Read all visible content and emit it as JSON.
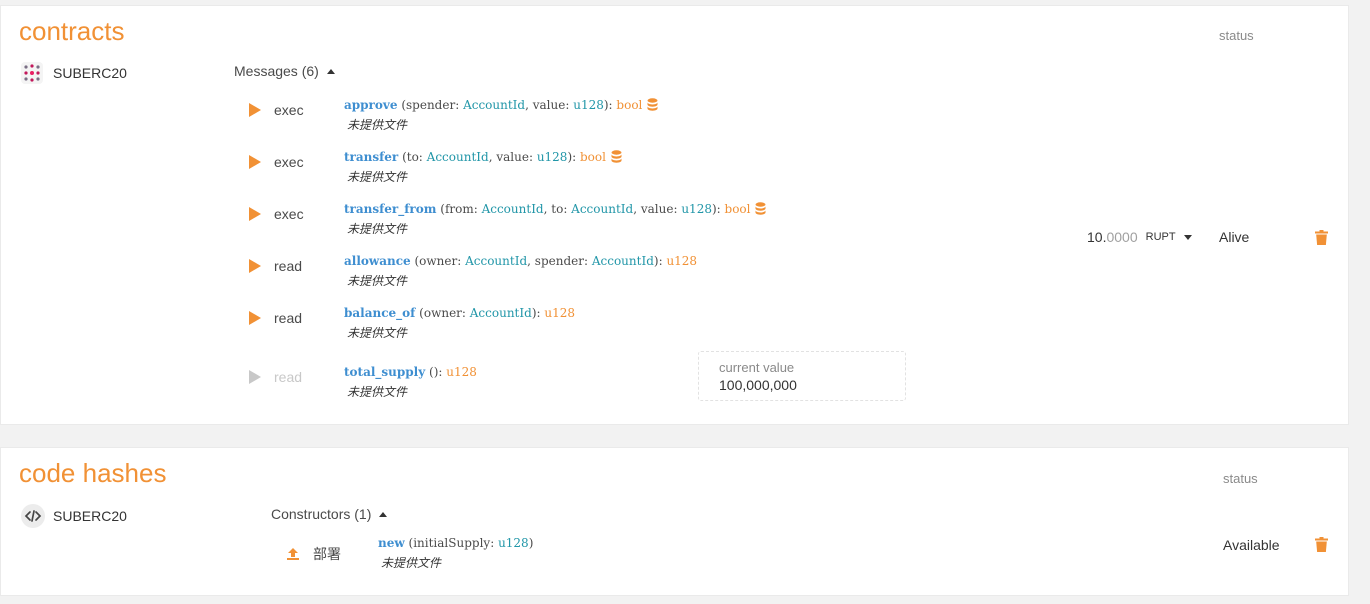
{
  "contracts": {
    "title": "contracts",
    "status_header": "status",
    "name": "SUBERC20",
    "messages_toggle": "Messages (6)",
    "messages": [
      {
        "action": "exec",
        "fn": "approve",
        "params": [
          {
            "name": "spender",
            "type": "AccountId"
          },
          {
            "name": "value",
            "type": "u128"
          }
        ],
        "ret": "bool",
        "storage_icon": true,
        "doc": "未提供文件"
      },
      {
        "action": "exec",
        "fn": "transfer",
        "params": [
          {
            "name": "to",
            "type": "AccountId"
          },
          {
            "name": "value",
            "type": "u128"
          }
        ],
        "ret": "bool",
        "storage_icon": true,
        "doc": "未提供文件"
      },
      {
        "action": "exec",
        "fn": "transfer_from",
        "params": [
          {
            "name": "from",
            "type": "AccountId"
          },
          {
            "name": "to",
            "type": "AccountId"
          },
          {
            "name": "value",
            "type": "u128"
          }
        ],
        "ret": "bool",
        "storage_icon": true,
        "doc": "未提供文件"
      },
      {
        "action": "read",
        "fn": "allowance",
        "params": [
          {
            "name": "owner",
            "type": "AccountId"
          },
          {
            "name": "spender",
            "type": "AccountId"
          }
        ],
        "ret": "u128",
        "storage_icon": false,
        "doc": "未提供文件"
      },
      {
        "action": "read",
        "fn": "balance_of",
        "params": [
          {
            "name": "owner",
            "type": "AccountId"
          }
        ],
        "ret": "u128",
        "storage_icon": false,
        "doc": "未提供文件"
      },
      {
        "action": "read",
        "fn": "total_supply",
        "params": [],
        "ret": "u128",
        "storage_icon": false,
        "doc": "未提供文件",
        "disabled": true
      }
    ],
    "current_value_label": "current value",
    "current_value": "100,000,000",
    "balance_int": "10.",
    "balance_dec": "0000",
    "balance_unit": "RUPT",
    "status": "Alive"
  },
  "code_hashes": {
    "title": "code hashes",
    "status_header": "status",
    "name": "SUBERC20",
    "constructors_toggle": "Constructors (1)",
    "constructor": {
      "action": "部署",
      "fn": "new",
      "params": [
        {
          "name": "initialSupply",
          "type": "u128"
        }
      ],
      "doc": "未提供文件"
    },
    "status": "Available"
  },
  "colors": {
    "accent": "#f19135",
    "fn": "#3e8ed0",
    "type": "#2196a8"
  }
}
